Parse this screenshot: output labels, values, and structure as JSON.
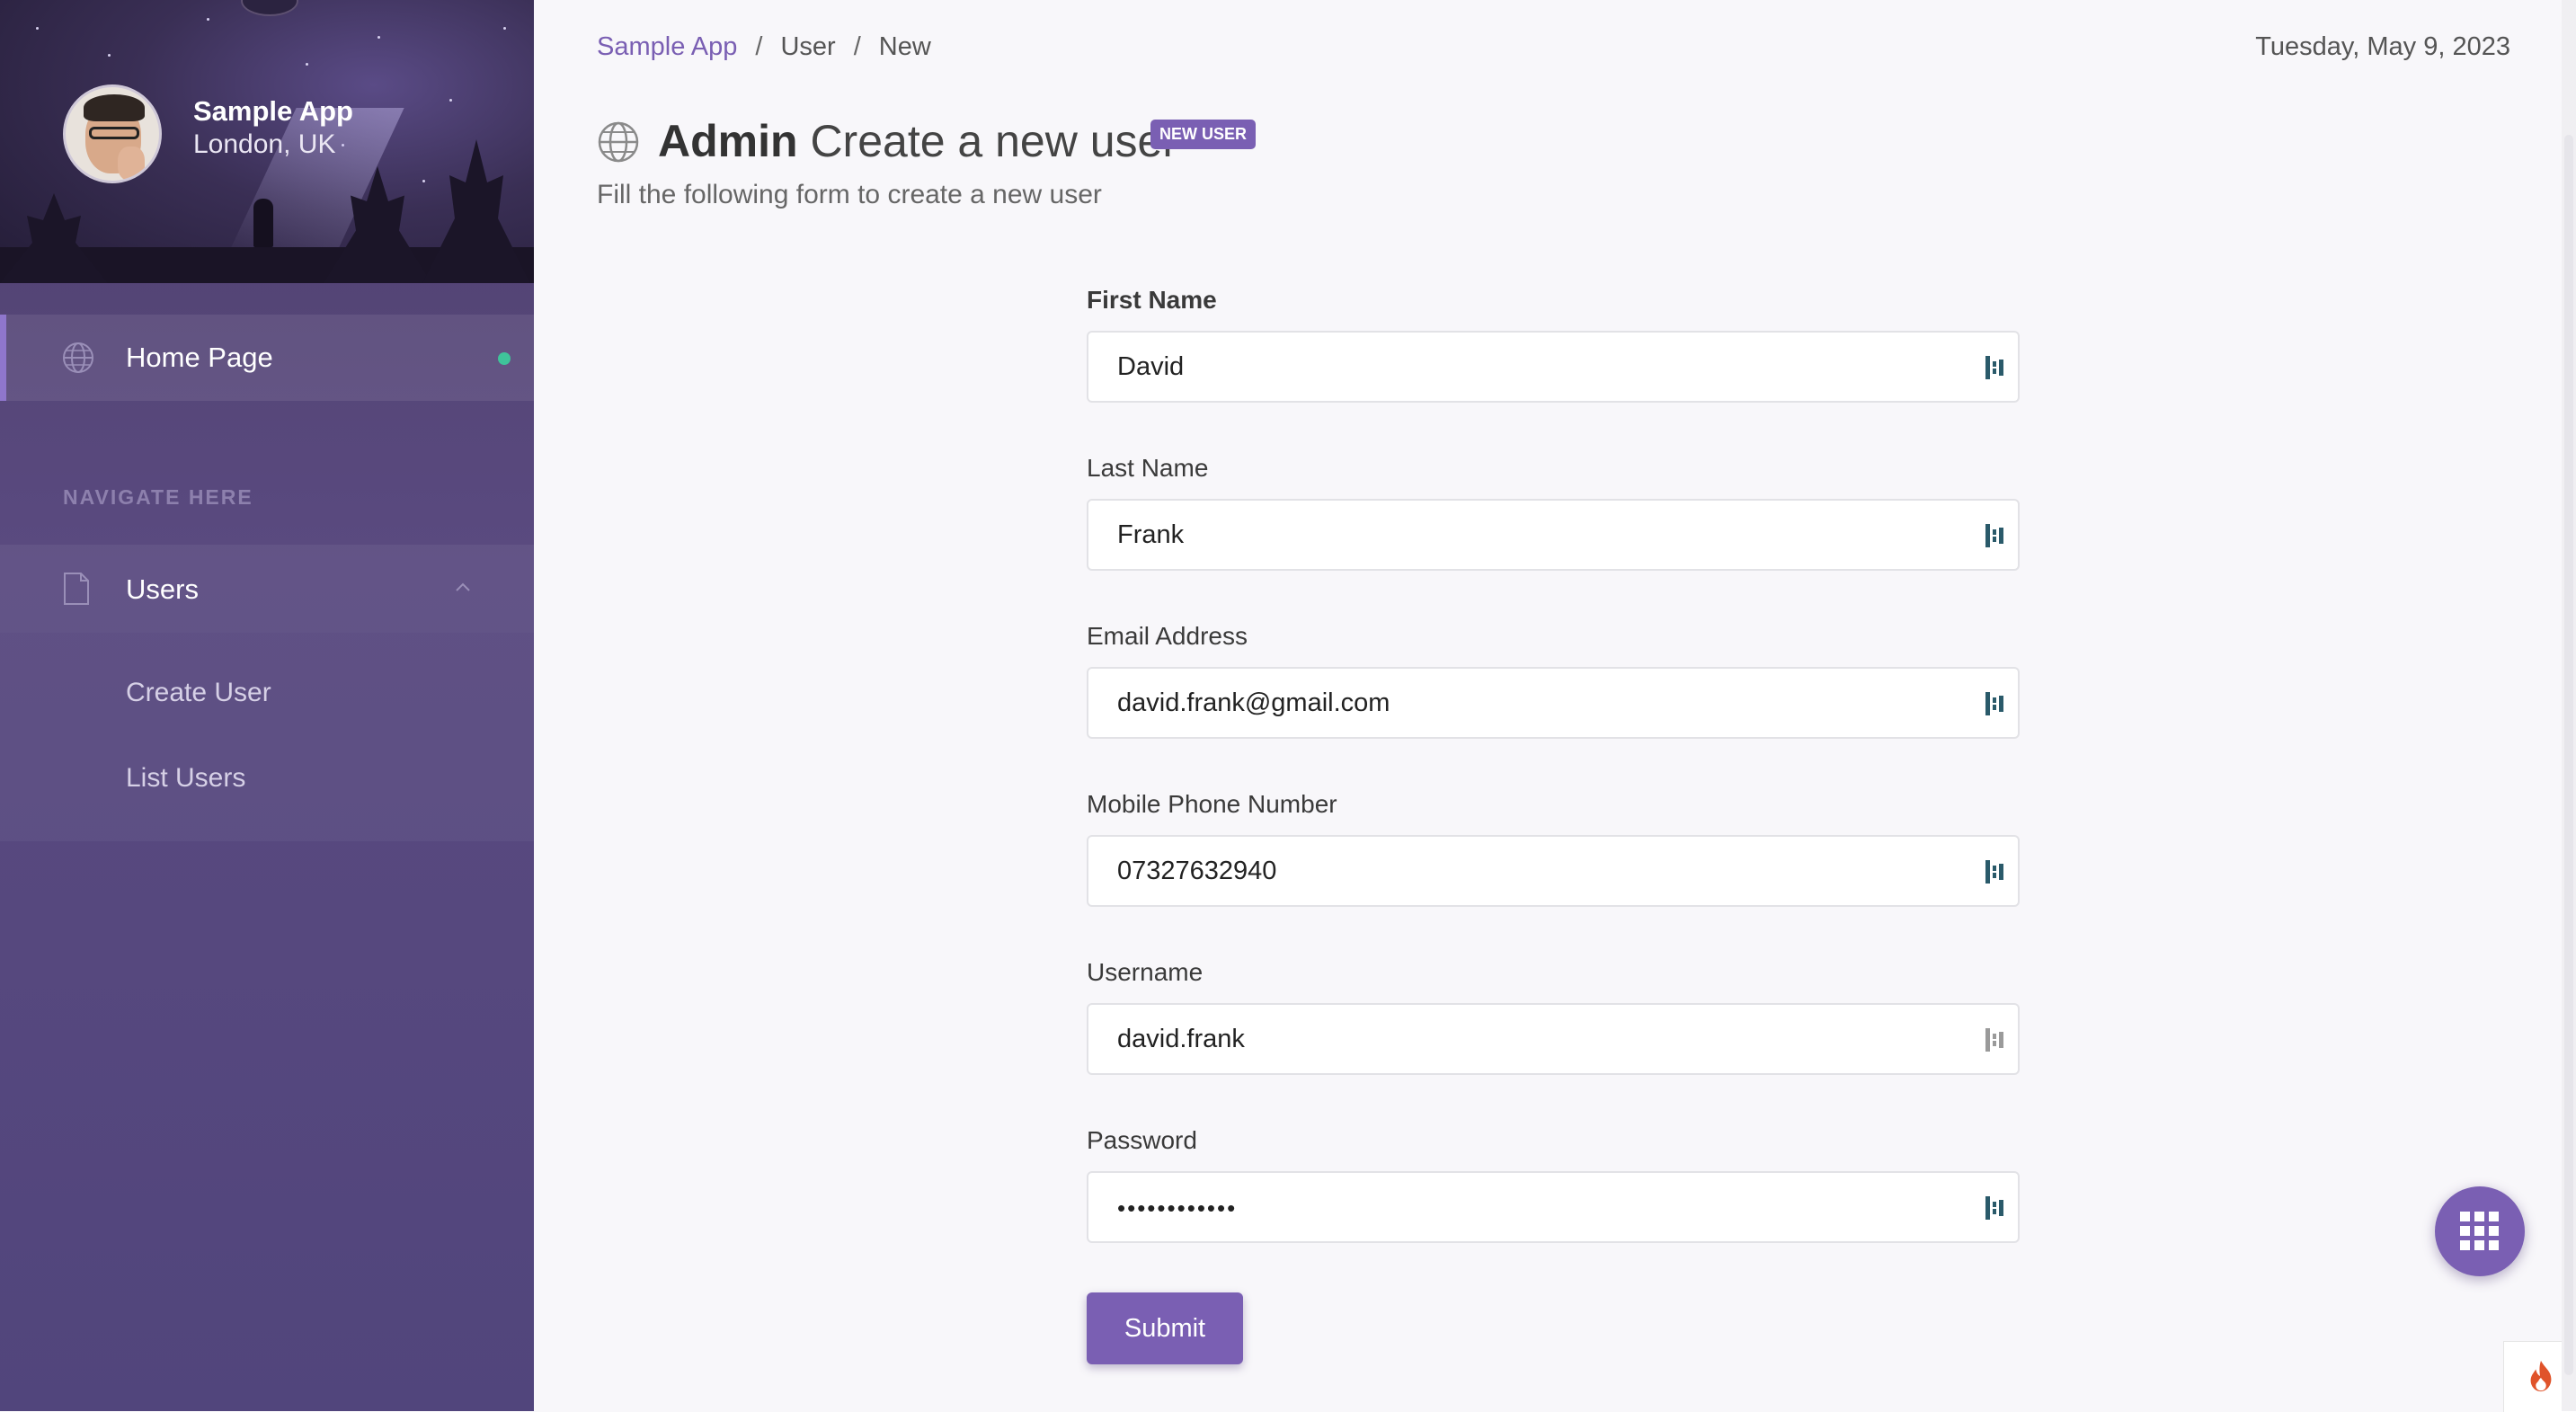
{
  "sidebar": {
    "brand_name": "Sample App",
    "brand_location": "London, UK",
    "home_label": "Home Page",
    "section_title": "NAVIGATE HERE",
    "users_label": "Users",
    "sub_items": [
      "Create User",
      "List Users"
    ]
  },
  "breadcrumb": {
    "items": [
      "Sample App",
      "User",
      "New"
    ],
    "separator": "/"
  },
  "date": "Tuesday, May 9, 2023",
  "header": {
    "title_bold": "Admin",
    "title_rest": "Create a new user",
    "badge": "NEW USER",
    "subtitle": "Fill the following form to create a new user"
  },
  "form": {
    "fields": [
      {
        "label": "First Name",
        "value": "David"
      },
      {
        "label": "Last Name",
        "value": "Frank"
      },
      {
        "label": "Email Address",
        "value": "david.frank@gmail.com"
      },
      {
        "label": "Mobile Phone Number",
        "value": "07327632940"
      },
      {
        "label": "Username",
        "value": "david.frank"
      },
      {
        "label": "Password",
        "value": "••••••••••••"
      }
    ],
    "submit_label": "Submit"
  },
  "colors": {
    "accent": "#7a5fb3",
    "status_dot": "#3fc39a"
  },
  "icons": {
    "home": "globe-icon",
    "users": "document-icon",
    "field": "keeper-password-manager-icon",
    "fab": "grid-menu-icon",
    "corner": "flame-icon"
  }
}
